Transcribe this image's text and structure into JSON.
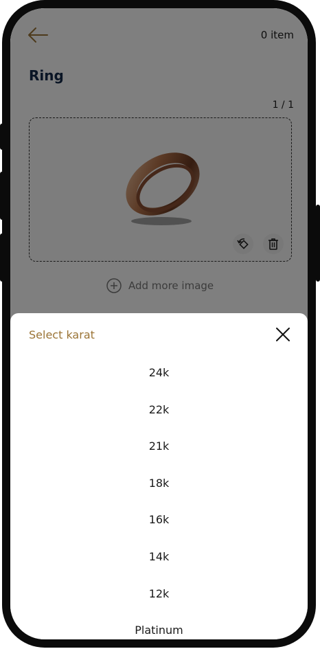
{
  "header": {
    "item_count": "0 item",
    "title": "Ring"
  },
  "gallery": {
    "counter": "1 / 1",
    "add_more_label": "Add more image"
  },
  "karat_sheet": {
    "title": "Select karat",
    "options": [
      "24k",
      "22k",
      "21k",
      "18k",
      "16k",
      "14k",
      "12k",
      "Platinum"
    ]
  },
  "colors": {
    "accent_gold": "#9b7436",
    "title_navy": "#142a4b",
    "overlay": "rgba(0,0,0,0.5)"
  },
  "icons": {
    "back": "arrow-left-icon",
    "rotate": "rotate-icon",
    "delete": "trash-icon",
    "add": "plus-circle-icon",
    "close": "close-icon"
  }
}
